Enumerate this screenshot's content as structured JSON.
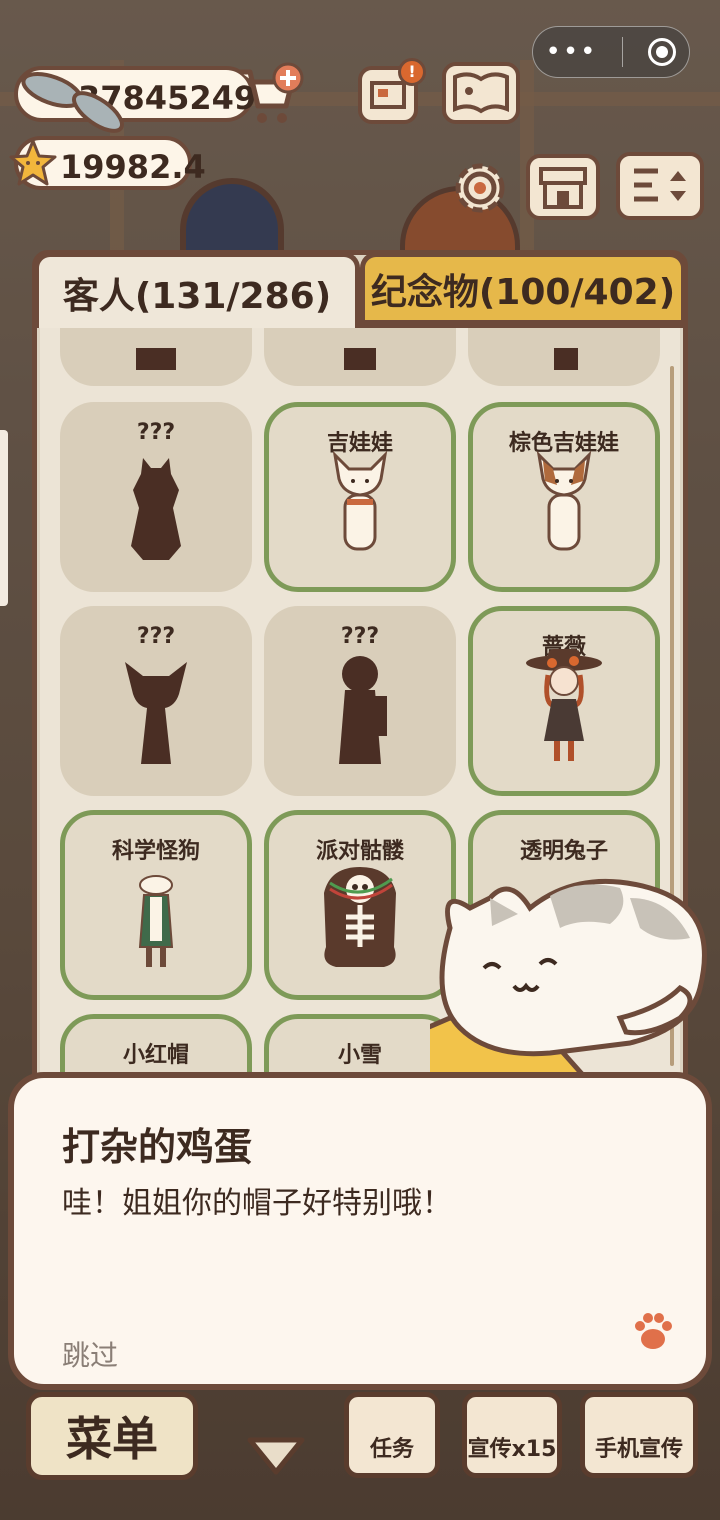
{
  "hud": {
    "fish_count": "37845249",
    "star_count": "19982.4",
    "icons": [
      "fish-icon",
      "cart-add-icon",
      "star-face-icon",
      "notice-board-icon",
      "paw-book-icon",
      "gear-icon",
      "shop-icon",
      "sort-icon"
    ]
  },
  "miniprogram_capsule": {
    "menu_icon": "more-dots-icon",
    "close_icon": "target-icon"
  },
  "tabs": [
    {
      "label": "客人(131/286)",
      "active": true
    },
    {
      "label": "纪念物(100/402)",
      "active": false
    }
  ],
  "guests": [
    {
      "name": "???",
      "owned": false
    },
    {
      "name": "吉娃娃",
      "owned": true
    },
    {
      "name": "棕色吉娃娃",
      "owned": true
    },
    {
      "name": "???",
      "owned": false
    },
    {
      "name": "???",
      "owned": false
    },
    {
      "name": "蔷薇",
      "owned": true
    },
    {
      "name": "科学怪狗",
      "owned": true
    },
    {
      "name": "派对骷髅",
      "owned": true
    },
    {
      "name": "透明兔子",
      "owned": true
    },
    {
      "name": "小红帽",
      "owned": true
    },
    {
      "name": "小雪",
      "owned": true
    }
  ],
  "dialog": {
    "speaker": "打杂的鸡蛋",
    "text": "哇！姐姐你的帽子好特别哦！",
    "skip_label": "跳过"
  },
  "bottom_bar": {
    "menu_label": "菜单",
    "task_label": "任务",
    "promo_label": "宣传x15",
    "phone_promo_label": "手机宣传"
  },
  "colors": {
    "outline": "#6d4a3a",
    "owned_border": "#7e9a58",
    "souvenir_tab": "#e6b84a",
    "dialog_bg": "#fdf6ee"
  }
}
